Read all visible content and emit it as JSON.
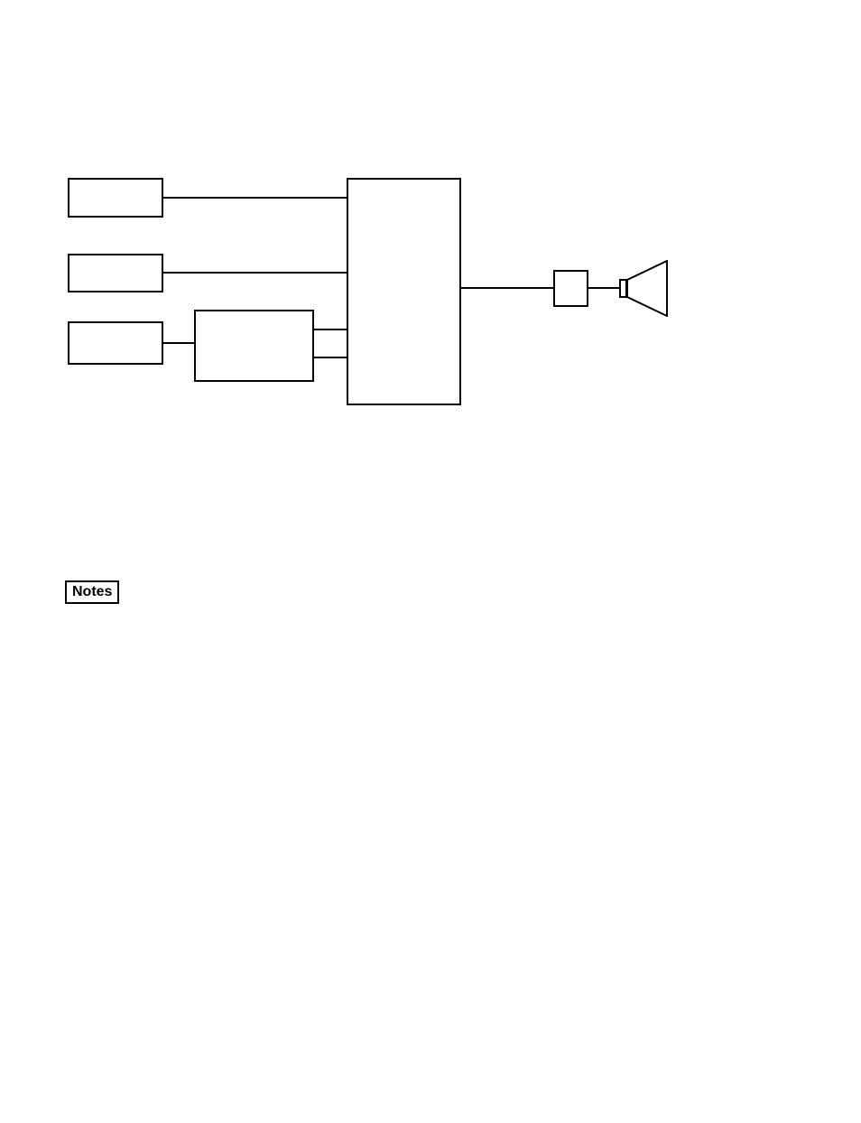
{
  "notes_label": "Notes"
}
